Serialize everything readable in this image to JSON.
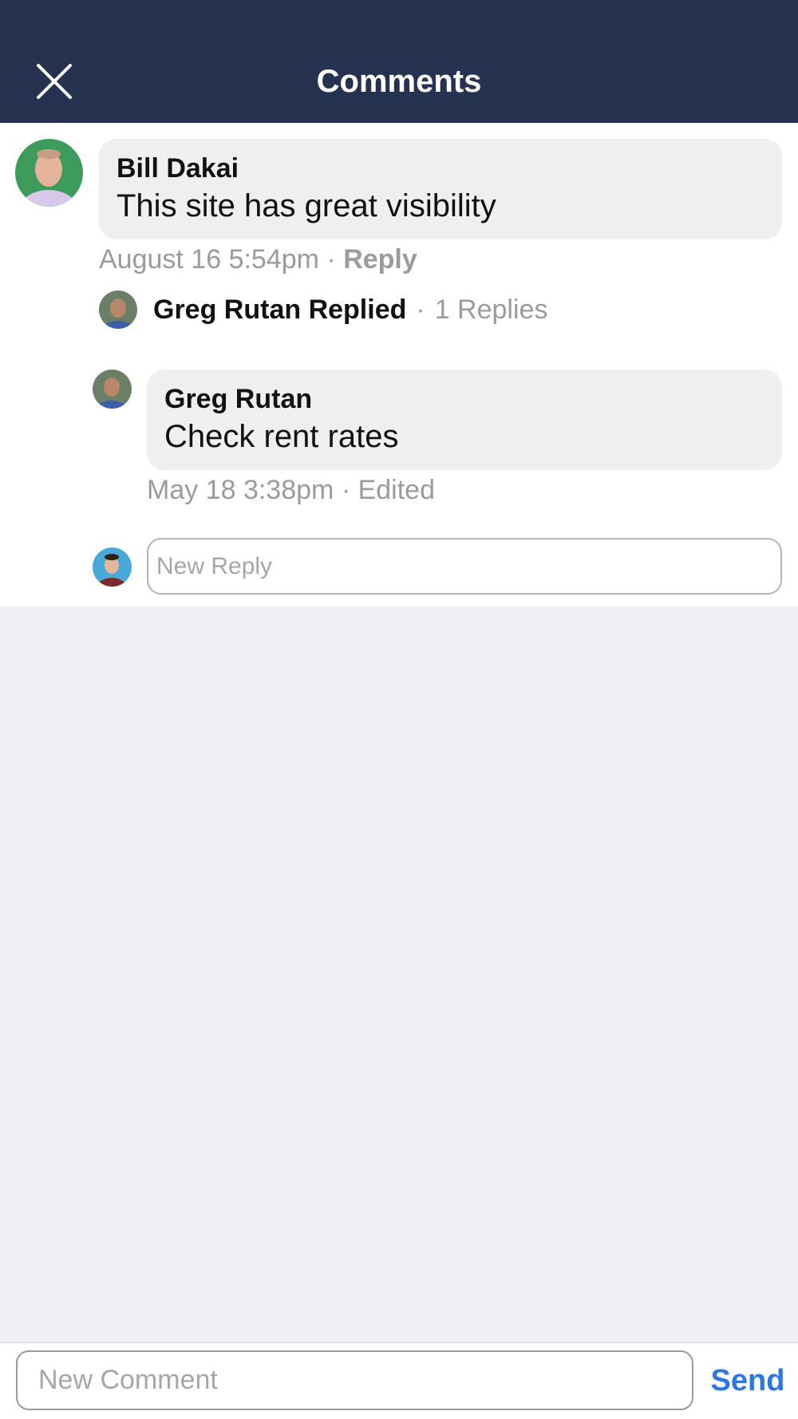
{
  "header": {
    "title": "Comments",
    "close_icon": "close-icon",
    "background": "#263350"
  },
  "comment": {
    "author": "Bill Dakai",
    "text": "This site has great visibility",
    "timestamp": "August 16 5:54pm",
    "separator": "·",
    "reply_label": "Reply",
    "replies_summary": {
      "replier": "Greg Rutan Replied",
      "separator": "·",
      "count_label": "1 Replies"
    }
  },
  "reply": {
    "author": "Greg Rutan",
    "text": "Check rent rates",
    "timestamp": "May 18 3:38pm",
    "separator": "·",
    "status": "Edited"
  },
  "reply_input": {
    "placeholder": "New Reply",
    "value": ""
  },
  "footer": {
    "comment_placeholder": "New Comment",
    "comment_value": "",
    "send_label": "Send",
    "send_color": "#3076e3"
  }
}
